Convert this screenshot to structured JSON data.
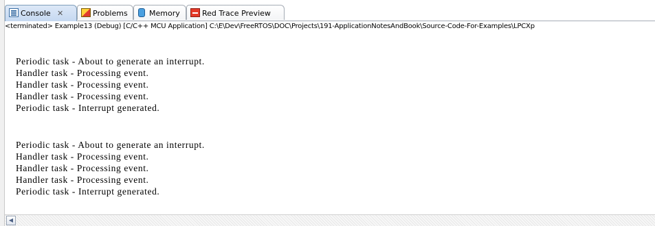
{
  "tabs": [
    {
      "label": "Console",
      "icon": "console-icon",
      "active": true,
      "close": "✕"
    },
    {
      "label": "Problems",
      "icon": "problems-icon"
    },
    {
      "label": "Memory",
      "icon": "memory-icon"
    },
    {
      "label": "Red Trace Preview",
      "icon": "trace-icon"
    }
  ],
  "status_line": "<terminated> Example13 (Debug) [C/C++ MCU Application] C:\\E\\Dev\\FreeRTOS\\DOC\\Projects\\191-ApplicationNotesAndBook\\Source-Code-For-Examples\\LPCXp",
  "console": {
    "lines": [
      "",
      "Periodic task - About to generate an interrupt.",
      "Handler task - Processing event.",
      "Handler task - Processing event.",
      "Handler task - Processing event.",
      "Periodic task - Interrupt generated.",
      "",
      "Periodic task - About to generate an interrupt.",
      "Handler task - Processing event.",
      "Handler task - Processing event.",
      "Handler task - Processing event.",
      "Periodic task - Interrupt generated."
    ]
  },
  "scrollbar": {
    "left_arrow": "◀"
  },
  "colors": {
    "active_tab": "#c6d9f1",
    "border": "#a5acb5"
  }
}
